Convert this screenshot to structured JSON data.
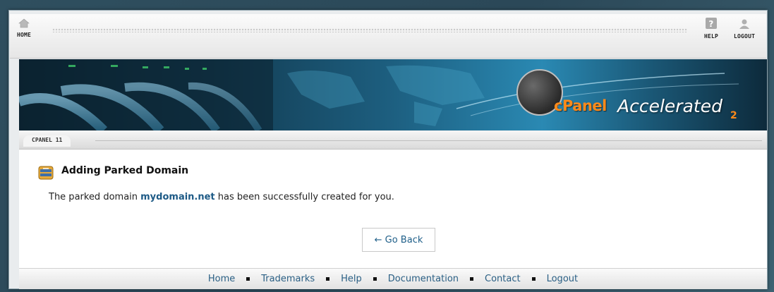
{
  "topbar": {
    "home_label": "HOME",
    "help_label": "HELP",
    "logout_label": "LOGOUT"
  },
  "banner": {
    "logo_cpanel": "cPanel",
    "logo_accelerated": "Accelerated",
    "logo_version": "2"
  },
  "version_tab": "CPANEL 11",
  "main": {
    "title": "Adding Parked Domain",
    "message_before": "The parked domain ",
    "message_domain": "mydomain.net",
    "message_after": " has been successfully created for you.",
    "go_back_label": "← Go Back"
  },
  "footer": {
    "links": [
      "Home",
      "Trademarks",
      "Help",
      "Documentation",
      "Contact",
      "Logout"
    ]
  },
  "colors": {
    "link": "#2a5f84",
    "domain": "#1d5a86",
    "logo_orange": "#ff8a1a"
  }
}
